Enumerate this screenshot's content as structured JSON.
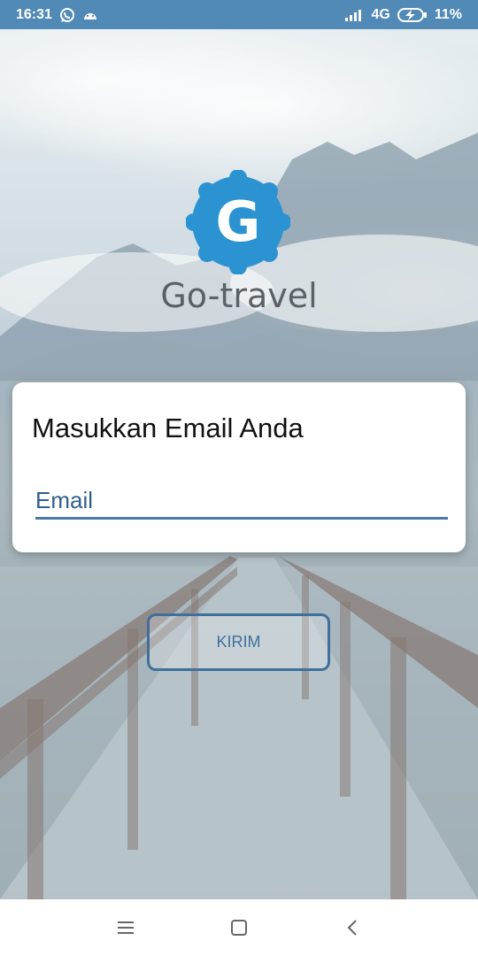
{
  "status_bar": {
    "time": "16:31",
    "network": "4G",
    "battery": "11%",
    "icons": [
      "whatsapp-icon",
      "android-icon",
      "signal-icon",
      "battery-charging-icon"
    ]
  },
  "app": {
    "logo_letter": "G",
    "name": "Go-travel"
  },
  "card": {
    "title": "Masukkan Email Anda",
    "email": {
      "placeholder": "Email",
      "value": ""
    }
  },
  "actions": {
    "submit_label": "KIRIM"
  },
  "nav_bar": {
    "icons": [
      "menu-icon",
      "home-icon",
      "back-icon"
    ]
  },
  "colors": {
    "status_bar": "#5189b7",
    "accent": "#3f6f9c",
    "logo": "#2b93d1"
  }
}
